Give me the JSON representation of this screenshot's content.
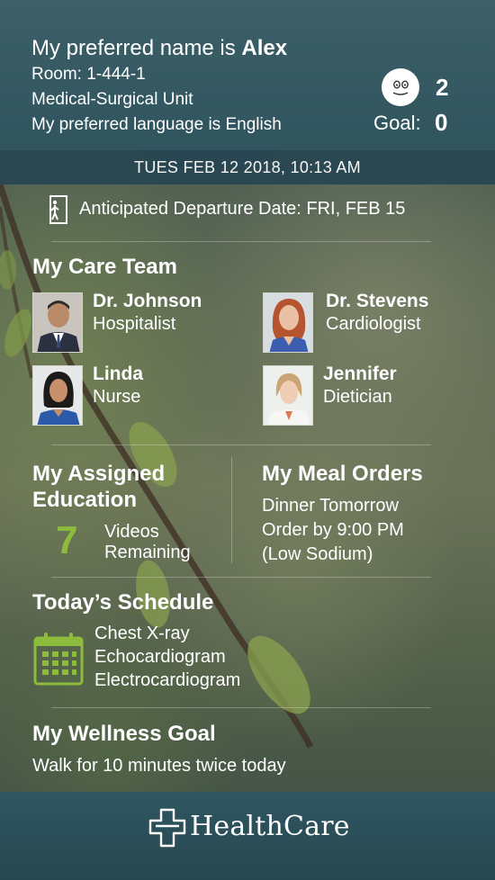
{
  "patient": {
    "name_prefix": "My preferred name is ",
    "name": "Alex",
    "room": "Room: 1-444-1",
    "unit": "Medical-Surgical Unit",
    "language": "My preferred language is English",
    "mood_count": "2",
    "goal_label": "Goal:",
    "goal_value": "0",
    "avatar_icon": "smiley-face-icon"
  },
  "datetime": "TUES FEB 12 2018, 10:13 AM",
  "departure": {
    "icon": "door-exit-icon",
    "text": "Anticipated Departure Date:  FRI, FEB 15"
  },
  "care_team": {
    "title": "My Care Team",
    "members": [
      {
        "name": "Dr. Johnson",
        "role": "Hospitalist"
      },
      {
        "name": "Dr. Stevens",
        "role": "Cardiologist"
      },
      {
        "name": "Linda",
        "role": "Nurse"
      },
      {
        "name": "Jennifer",
        "role": "Dietician"
      }
    ]
  },
  "education": {
    "title_line1": "My Assigned",
    "title_line2": "Education",
    "count": "7",
    "label_line1": "Videos",
    "label_line2": "Remaining",
    "accent_color": "#8dbb3c"
  },
  "meals": {
    "title": "My Meal Orders",
    "lines": [
      "Dinner Tomorrow",
      "Order by 9:00 PM",
      "(Low Sodium)"
    ]
  },
  "schedule": {
    "title": "Today’s Schedule",
    "icon": "calendar-icon",
    "items": [
      "Chest X-ray",
      "Echocardiogram",
      "Electrocardiogram"
    ]
  },
  "wellness": {
    "title": "My Wellness Goal",
    "text": "Walk for 10 minutes twice today"
  },
  "brand": {
    "icon": "medical-cross-icon",
    "name": "HealthCare"
  }
}
